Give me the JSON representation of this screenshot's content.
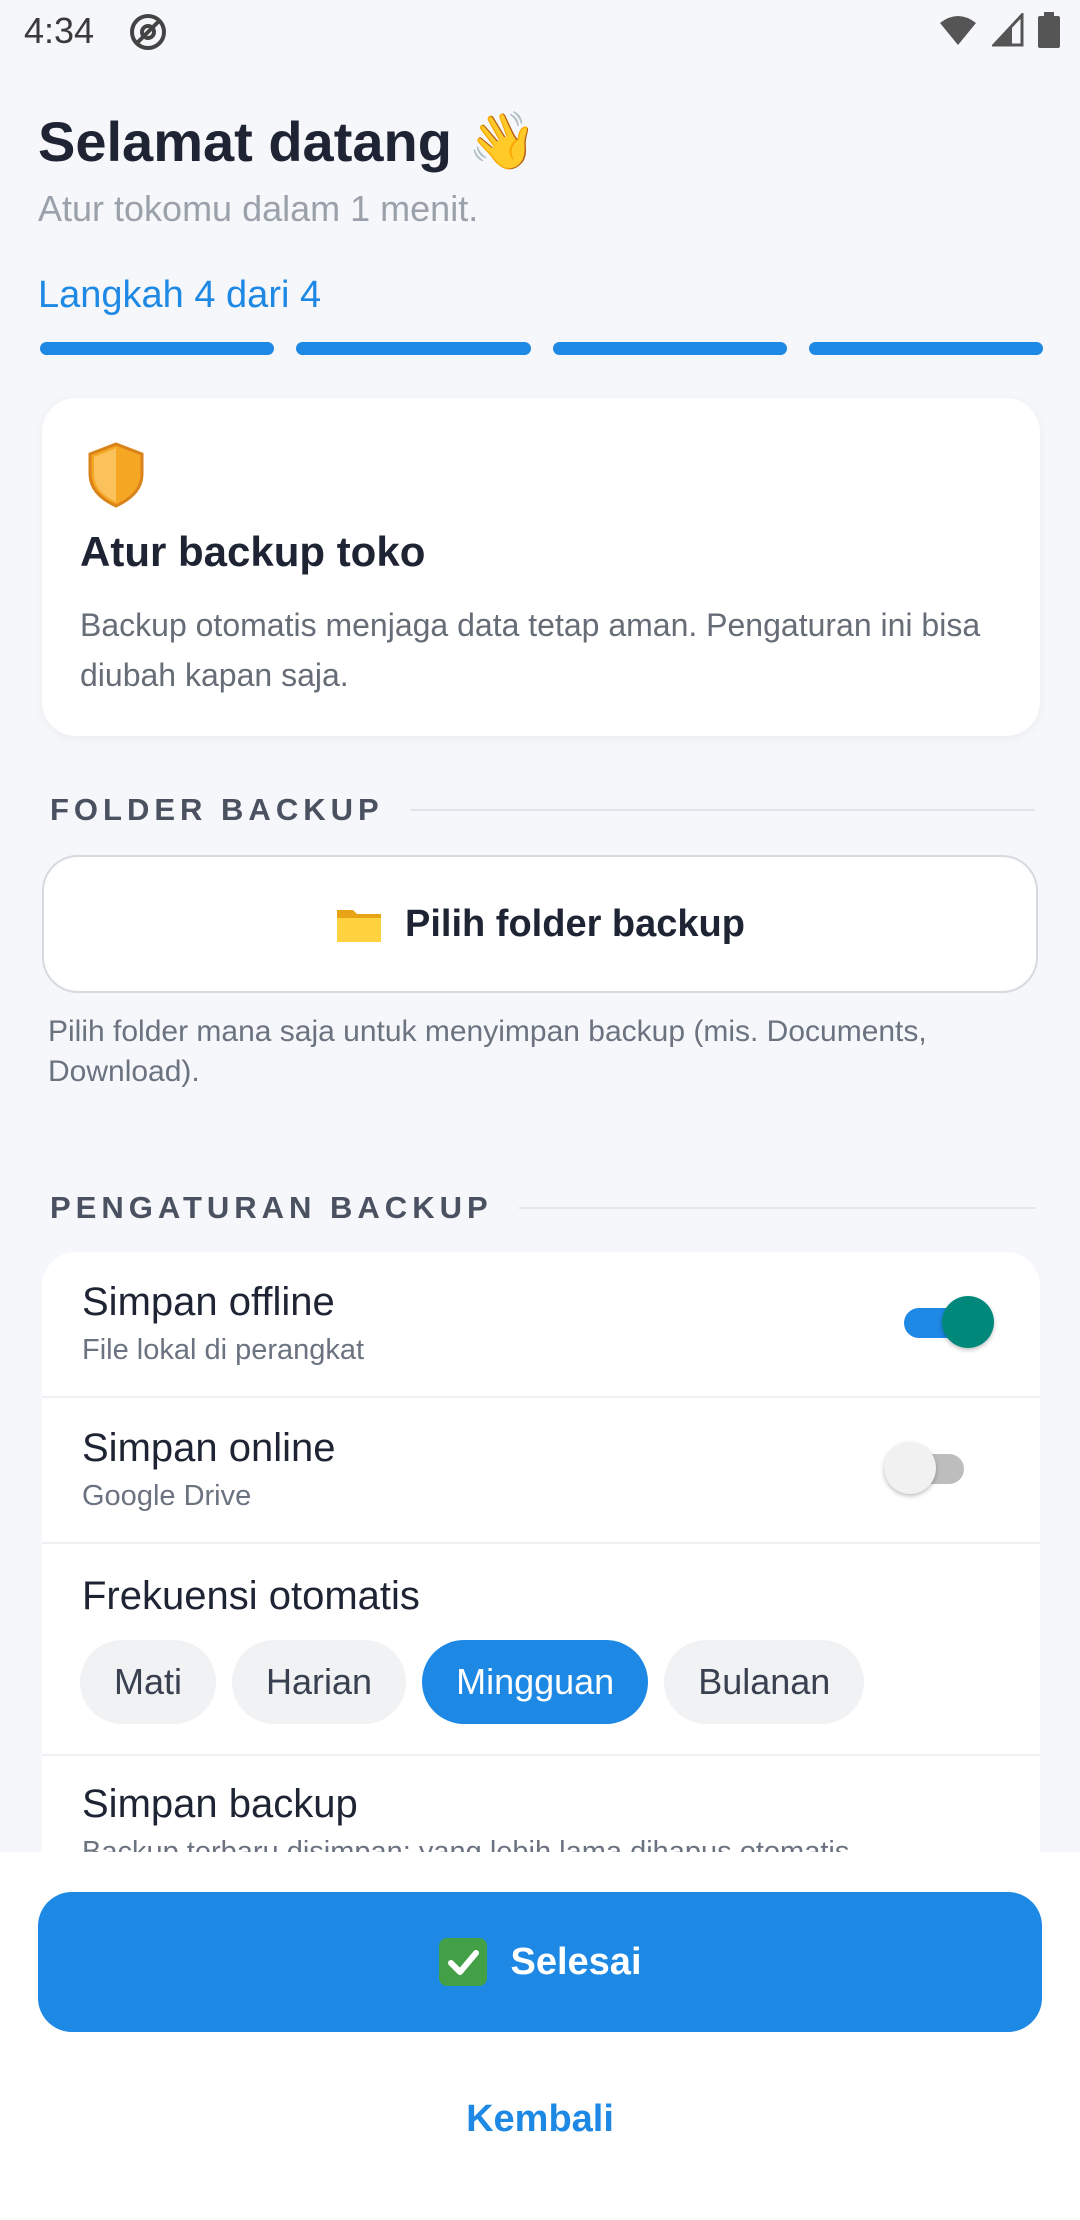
{
  "status_bar": {
    "time": "4:34"
  },
  "header": {
    "title": "Selamat datang",
    "wave_emoji": "👋",
    "subtitle": "Atur tokomu dalam 1 menit.",
    "step_label": "Langkah 4 dari 4",
    "progress": {
      "current_step": 4,
      "total_steps": 4
    }
  },
  "info_card": {
    "icon": "shield-icon",
    "title": "Atur backup toko",
    "description": "Backup otomatis menjaga data tetap aman. Pengaturan ini bisa diubah kapan saja."
  },
  "folder_section": {
    "heading": "FOLDER BACKUP",
    "button_label": "Pilih folder backup",
    "button_icon": "folder-icon",
    "hint": "Pilih folder mana saja untuk menyimpan backup (mis. Documents, Download)."
  },
  "settings_section": {
    "heading": "PENGATURAN BACKUP",
    "offline": {
      "title": "Simpan offline",
      "subtitle": "File lokal di perangkat",
      "enabled": true
    },
    "online": {
      "title": "Simpan online",
      "subtitle": "Google Drive",
      "enabled": false
    },
    "frequency": {
      "title": "Frekuensi otomatis",
      "options": [
        "Mati",
        "Harian",
        "Mingguan",
        "Bulanan"
      ],
      "selected": "Mingguan"
    },
    "retention": {
      "title": "Simpan backup",
      "subtitle": "Backup terbaru disimpan; yang lebih lama dihapus otomatis."
    }
  },
  "actions": {
    "done_label": "Selesai",
    "done_icon": "check-icon",
    "back_label": "Kembali"
  },
  "colors": {
    "accent": "#1E88E5",
    "toggle_thumb_on": "#00897B",
    "background": "#F5F7FA"
  }
}
